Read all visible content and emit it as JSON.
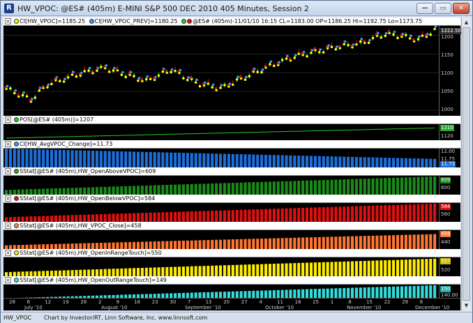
{
  "window": {
    "title": "HW_VPOC: @ES# (405m) E-MINI S&P 500 DEC 2010 405 Minutes, Session 2",
    "app_icon_letter": "R",
    "minimize_glyph": "—",
    "maximize_glyph": "▭",
    "close_glyph": "✕"
  },
  "scroll": {
    "up_glyph": "▲",
    "down_glyph": "▼"
  },
  "panes": {
    "price": {
      "close_glyph": "×",
      "legend": [
        {
          "dot_color": "#ffff00",
          "text": "CI[HW_VPOC]=1185.25"
        },
        {
          "dot_color": "#3399ff",
          "text": "CI[HW_VPOC_PREV]=1180.25"
        },
        {
          "dot_color": "#22cc22",
          "dot_color2": "#dd1111",
          "text": "@ES# (405m)-11/01/10 16:15 CL=1183.00 OP=1186.25 Hi=1192.75 Lo=1173.75"
        }
      ],
      "yticks": [
        "1200",
        "1150",
        "1100",
        "1050",
        "1000"
      ],
      "badge": "1222.50",
      "badge_color": "#333333"
    },
    "pos": {
      "close_glyph": "×",
      "dot_color": "#22cc22",
      "legend": "POS[@ES# (405m)]=1207",
      "yticks": [
        "1120"
      ],
      "badge": "1210",
      "badge_color": "#22aa22"
    },
    "avgvpoc": {
      "close_glyph": "×",
      "dot_color": "#3399ff",
      "legend": "CI[HW_AvgVPOC_Change]=11.73",
      "yticks": [
        "12.00",
        "11.75"
      ],
      "badge": "11.73",
      "badge_color": "#1e6fd9"
    },
    "openabove": {
      "close_glyph": "×",
      "dot_color": "#22aa22",
      "legend": "SStat[@ES# (405m),HW_OpenAboveVPOC]=609",
      "yticks": [
        "600"
      ],
      "badge": "609",
      "badge_color": "#1a8a1a"
    },
    "openbelow": {
      "close_glyph": "×",
      "dot_color": "#dd1111",
      "legend": "SStat[@ES# (405m),HW_OpenBelowVPOC]=584",
      "yticks": [
        "560"
      ],
      "badge": "584",
      "badge_color": "#dd1111"
    },
    "vpocclose": {
      "close_glyph": "×",
      "dot_color": "#ff8844",
      "legend": "SStat[@ES# (405m),HW_VPOC_Close]=458",
      "yticks": [
        "440"
      ],
      "badge": "458",
      "badge_color": "#ff7733"
    },
    "openinrange": {
      "close_glyph": "×",
      "dot_color": "#ffee00",
      "legend": "SStat[@ES# (405m),HW_OpenInRangeTouch]=550",
      "yticks": [
        "520"
      ],
      "badge": "557",
      "badge_color": "#ccbb00"
    },
    "openoutrange": {
      "close_glyph": "×",
      "dot_color": "#33dddd",
      "legend": "SStat[@ES# (405m),HW_OpenOutRangeTouch]=149",
      "yticks": [
        "140.00"
      ],
      "badge": "150",
      "badge_color": "#22aaaa"
    }
  },
  "xaxis": {
    "ticks": [
      "28",
      "6",
      "12",
      "19",
      "26",
      "2",
      "9",
      "16",
      "23",
      "30",
      "7",
      "13",
      "20",
      "27",
      "4",
      "11",
      "18",
      "25",
      "1",
      "8",
      "15",
      "22",
      "29",
      "6"
    ],
    "months": [
      "July '10",
      "August '10",
      "September '10",
      "October '10",
      "November '10",
      "December '10"
    ]
  },
  "status": {
    "symbol": "HW_VPOC",
    "credit": "Chart by Investor/RT, Linn Software, Inc. www.linnsoft.com"
  },
  "colors": {
    "pos_line": "#22cc22",
    "avgvpoc_bars": "#1e6fd9",
    "openabove_bars": "#1a8a1a",
    "openbelow_bars": "#dd1111",
    "vpocclose_bars": "#ff7733",
    "openinrange_bars": "#ffee00",
    "openoutrange_bars": "#33dddd",
    "vpoc_dot": "#ffff00",
    "vpoc_prev_dot": "#3399ff",
    "up_bar": "#22cc22",
    "down_bar": "#dd1111"
  }
}
